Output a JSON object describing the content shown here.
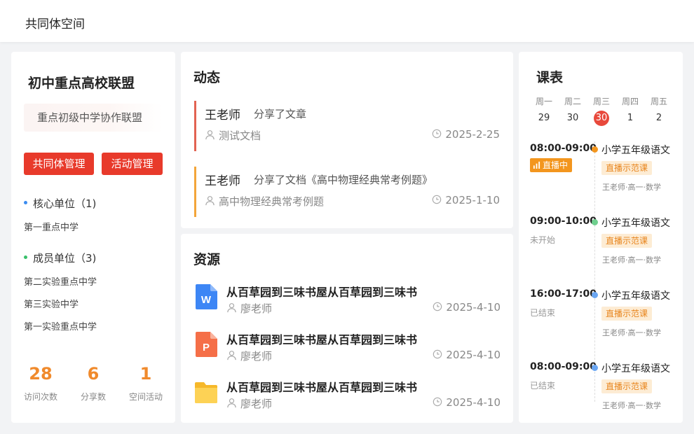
{
  "app": {
    "title": "共同体空间"
  },
  "alliance": {
    "name": "初中重点高校联盟",
    "subtitle": "重点初级中学协作联盟",
    "manage_label": "共同体管理",
    "activity_label": "活动管理",
    "core": {
      "label": "核心单位（1)",
      "dot_color": "#3b8cf0",
      "schools": [
        "第一重点中学"
      ]
    },
    "members": {
      "label": "成员单位（3)",
      "dot_color": "#38c06a",
      "schools": [
        "第二实验重点中学",
        "第三实验中学",
        "第一实验重点中学"
      ]
    },
    "stats": [
      {
        "value": "28",
        "label": "访问次数"
      },
      {
        "value": "6",
        "label": "分享数"
      },
      {
        "value": "1",
        "label": "空间活动"
      }
    ]
  },
  "feed": {
    "title": "动态",
    "items": [
      {
        "author": "王老师",
        "action": "分享了文章",
        "doc": "测试文档",
        "date": "2025-2-25",
        "color": "#e26352"
      },
      {
        "author": "王老师",
        "action": "分享了文档《高中物理经典常考例题》",
        "doc": "高中物理经典常考例题",
        "date": "2025-1-10",
        "color": "#f3a53a"
      }
    ]
  },
  "resources": {
    "title": "资源",
    "items": [
      {
        "title": "从百草园到三味书屋从百草园到三味书",
        "author": "廖老师",
        "date": "2025-4-10",
        "icon": "word-file-icon",
        "badge": "W"
      },
      {
        "title": "从百草园到三味书屋从百草园到三味书",
        "author": "廖老师",
        "date": "2025-4-10",
        "icon": "ppt-file-icon",
        "badge": "P"
      },
      {
        "title": "从百草园到三味书屋从百草园到三味书",
        "author": "廖老师",
        "date": "2025-4-10",
        "icon": "folder-icon",
        "badge": ""
      }
    ]
  },
  "schedule": {
    "title": "课表",
    "weekdays": [
      "周一",
      "周二",
      "周三",
      "周四",
      "周五"
    ],
    "dates": [
      "29",
      "30",
      "30",
      "1",
      "2"
    ],
    "today_index": 2,
    "slots": [
      {
        "time": "08:00-09:00",
        "status": "直播中",
        "live": true,
        "dot_color": "#f3961e",
        "course": "小学五年级语文",
        "tag": "直播示范课",
        "teacher": "王老师·高一·数学"
      },
      {
        "time": "09:00-10:00",
        "status": "未开始",
        "live": false,
        "dot_color": "#6fcf8e",
        "course": "小学五年级语文",
        "tag": "直播示范课",
        "teacher": "王老师·高一·数学"
      },
      {
        "time": "16:00-17:00",
        "status": "已结束",
        "live": false,
        "dot_color": "#6aa6f2",
        "course": "小学五年级语文",
        "tag": "直播示范课",
        "teacher": "王老师·高一·数学"
      },
      {
        "time": "08:00-09:00",
        "status": "已结束",
        "live": false,
        "dot_color": "#6aa6f2",
        "course": "小学五年级语文",
        "tag": "直播示范课",
        "teacher": "王老师·高一·数学"
      }
    ]
  }
}
